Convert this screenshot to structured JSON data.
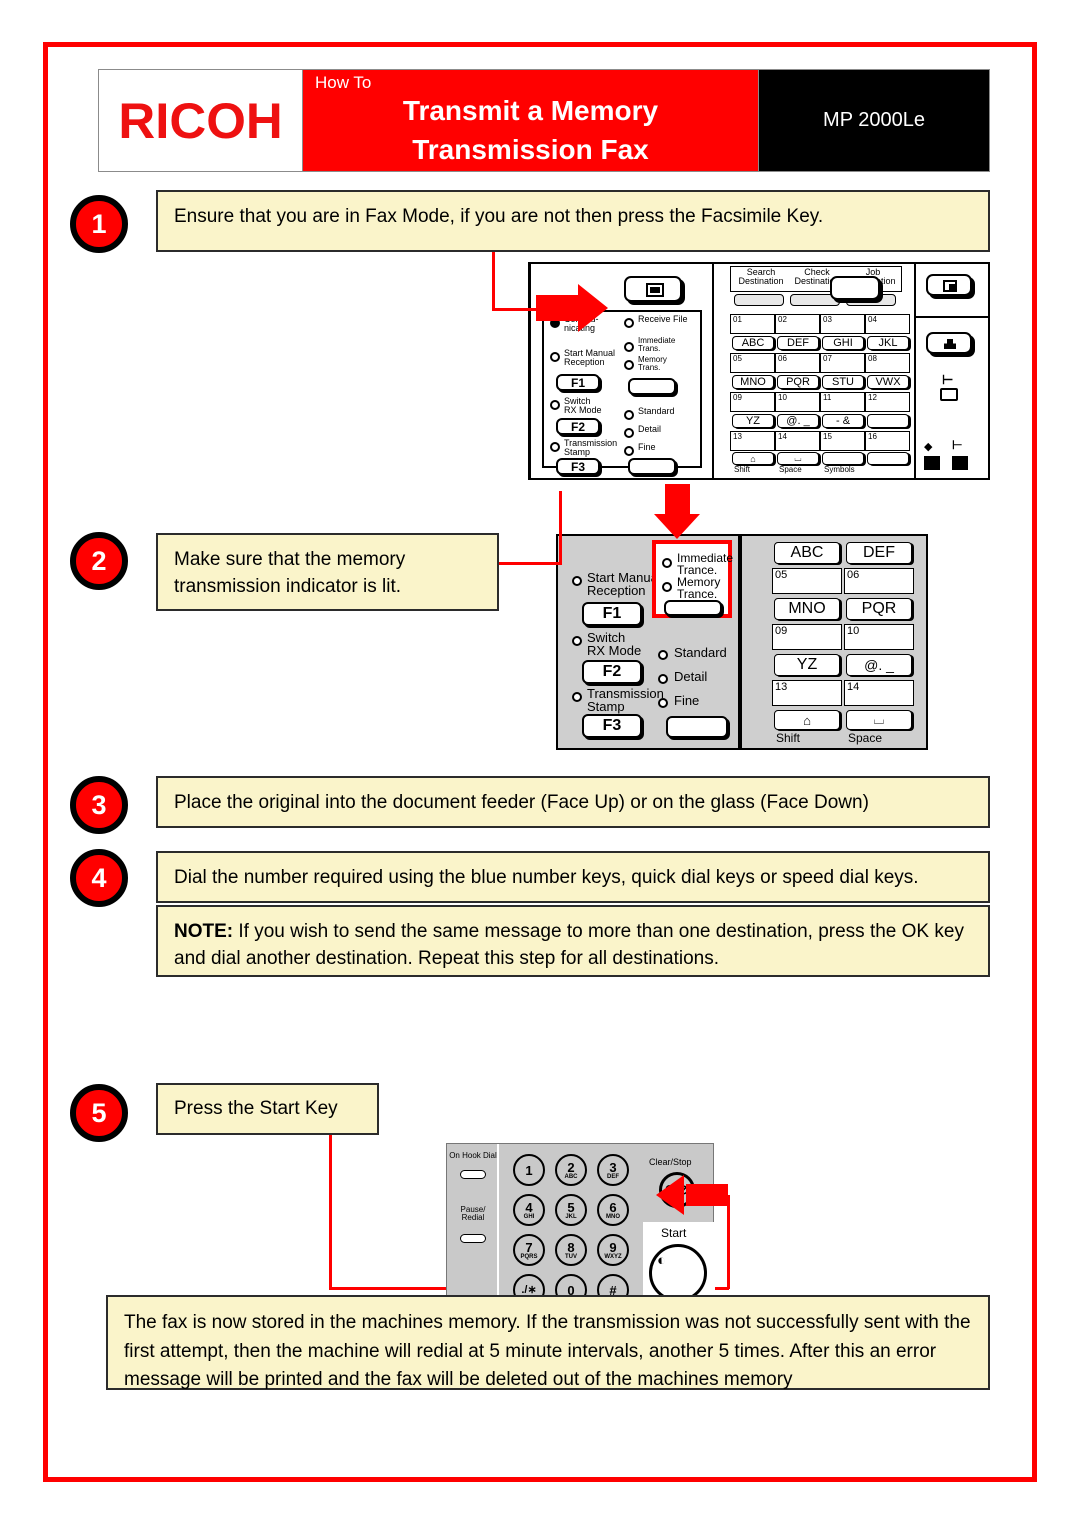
{
  "document": {
    "brand": "RICOH",
    "howto_label": "How To",
    "title_line1": "Transmit a Memory",
    "title_line2": "Transmission Fax",
    "model": "MP 2000Le",
    "accent_red": "#ff0000",
    "callout_yellow": "#faf4ca",
    "panel_grey": "#cfcfcf"
  },
  "steps": [
    {
      "number": "1",
      "text": "Ensure that you are in Fax Mode, if you are not then press the Facsimile Key."
    },
    {
      "number": "2",
      "text": "Make sure that the memory transmission indicator is lit."
    },
    {
      "number": "3",
      "text": "Place the original into the document feeder (Face Up) or on the glass (Face Down)"
    },
    {
      "number": "4",
      "text": "Dial the number required using the blue number keys, quick dial keys or speed dial keys."
    },
    {
      "number": "5",
      "text": "Press the Start Key"
    }
  ],
  "note": {
    "prefix": "NOTE:",
    "text": " If you wish to send the same message to more than one destination, press the OK key and dial another destination. Repeat this step for all destinations."
  },
  "footer": {
    "text": "The fax is now stored in the machines memory. If the transmission was not successfully sent with the first attempt, then the machine will redial at 5 minute intervals, another 5 times. After this an error message will be printed and the fax will be deleted out of the machines memory"
  },
  "control_panel": {
    "top_keys": [
      {
        "label": "Search\nDestination"
      },
      {
        "label": "Check\nDestination"
      },
      {
        "label": "Job\nInformation"
      }
    ],
    "indicators": [
      {
        "label": "Commu-\nnicating",
        "lit": true
      },
      {
        "label": "Start Manual\nReception",
        "lit": false
      },
      {
        "label": "Switch\nRX Mode",
        "lit": false
      },
      {
        "label": "Transmission\nStamp",
        "lit": false
      }
    ],
    "indicators_right": [
      {
        "label": "Receive File",
        "lit": false
      },
      {
        "label": "Immediate\nTrans.",
        "lit": false
      },
      {
        "label": "Memory\nTrans.",
        "lit": false
      },
      {
        "label": "Standard",
        "lit": false
      },
      {
        "label": "Detail",
        "lit": false
      },
      {
        "label": "Fine",
        "lit": false
      }
    ],
    "function_keys": [
      "F1",
      "F2",
      "F3"
    ],
    "quick_dial_numbers": [
      "01",
      "02",
      "03",
      "04",
      "05",
      "06",
      "07",
      "08",
      "09",
      "10",
      "11",
      "12",
      "13",
      "14",
      "15",
      "16"
    ],
    "quick_dial_letters": [
      "ABC",
      "DEF",
      "GHI",
      "JKL",
      "MNO",
      "PQR",
      "STU",
      "VWX",
      "YZ",
      "@. _",
      "- &",
      ""
    ],
    "bottom_keys": [
      {
        "glyph": "shift-icon",
        "label": "Shift"
      },
      {
        "glyph": "space-icon",
        "label": "Space"
      },
      {
        "glyph": "symbols-icon",
        "label": "Symbols"
      },
      {
        "glyph": "blank-icon",
        "label": ""
      }
    ],
    "side_icons": [
      {
        "name": "facsimile-key-icon"
      },
      {
        "name": "scanner-key-icon"
      },
      {
        "name": "copy-key-icon"
      },
      {
        "name": "printer-key-icon"
      }
    ]
  },
  "panel_step2": {
    "indicators_left": [
      {
        "label": "Start Manual\nReception"
      },
      {
        "label": "Switch\nRX Mode"
      },
      {
        "label": "Transmission\nStamp"
      }
    ],
    "highlight": [
      {
        "label": "Immediate\nTrance."
      },
      {
        "label": "Memory\nTrance."
      }
    ],
    "indicators_right": [
      "Standard",
      "Detail",
      "Fine"
    ],
    "function_keys": [
      "F1",
      "F2",
      "F3"
    ],
    "quick_dial_numbers": [
      "05",
      "06",
      "09",
      "10",
      "13",
      "14"
    ],
    "quick_dial_letters": [
      "ABC",
      "DEF",
      "MNO",
      "PQR",
      "YZ",
      "@. _"
    ],
    "bottom_labels": [
      "Shift",
      "Space"
    ]
  },
  "keypad": {
    "on_hook_dial": "On Hook Dial",
    "pause_redial": "Pause/\nRedial",
    "clear_stop_label": "Clear/Stop",
    "clear_stop_glyph": "C/⊘",
    "start_label": "Start",
    "start_glyph": "⬤",
    "buttons": [
      {
        "num": "1",
        "sub": ""
      },
      {
        "num": "2",
        "sub": "ABC"
      },
      {
        "num": "3",
        "sub": "DEF"
      },
      {
        "num": "4",
        "sub": "GHI"
      },
      {
        "num": "5",
        "sub": "JKL"
      },
      {
        "num": "6",
        "sub": "MNO"
      },
      {
        "num": "7",
        "sub": "PQRS"
      },
      {
        "num": "8",
        "sub": "TUV"
      },
      {
        "num": "9",
        "sub": "WXYZ"
      },
      {
        "num": "./∗",
        "sub": ""
      },
      {
        "num": "0",
        "sub": ""
      },
      {
        "num": "#",
        "sub": ""
      }
    ]
  }
}
